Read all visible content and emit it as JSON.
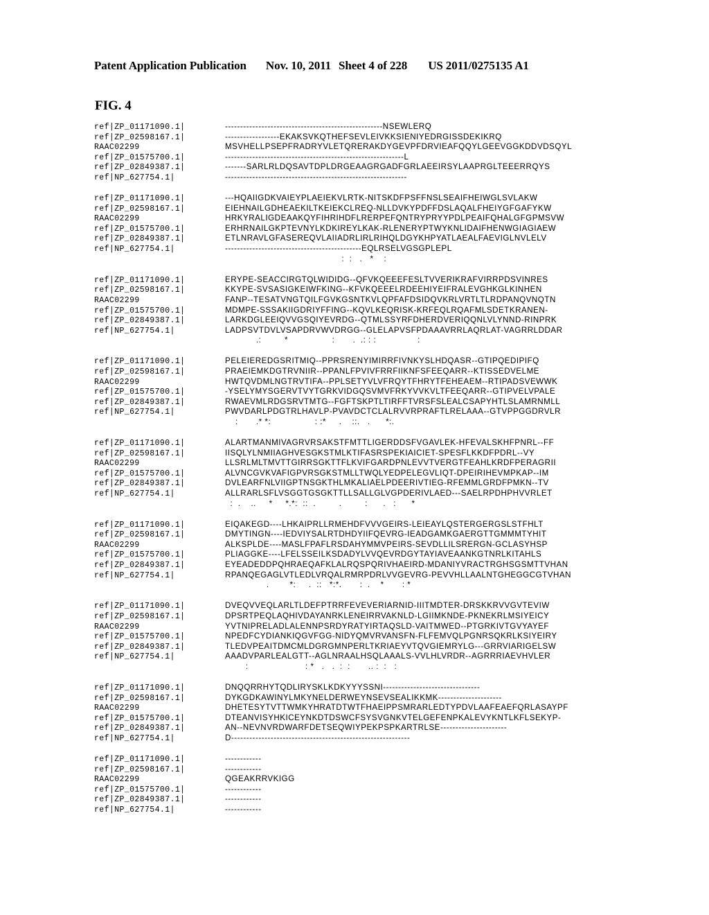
{
  "header": {
    "publication": "Patent Application Publication",
    "date": "Nov. 10, 2011",
    "sheet": "Sheet 4 of 228",
    "patent_number": "US 2011/0275135 A1"
  },
  "figure": {
    "label": "FIG. 4"
  },
  "sequence_labels": [
    "ref|ZP_01171090.1|",
    "ref|ZP_02598167.1|",
    "RAAC02299",
    "ref|ZP_01575700.1|",
    "ref|ZP_02849387.1|",
    "ref|NP_627754.1|"
  ],
  "blocks": [
    {
      "sequences": [
        "----------------------------------------------------NSEWLERQ",
        "------------------EKAKSVKQTHEFSEVLEIVKKSIENIYEDRGISSDEKIKRQ",
        "MSVHELLPSEPFRADRYVLETQRERAKDYGEVPFDRVIEAFQQYLGEEVGGKDDVDSQYL",
        "-----------------------------------------------------------L",
        "-------SARLRLDQSAVTDPLDRGEAAGRGADFGRLAEEIRSYLAAPRGLTEEERRQYS",
        "------------------------------------------------------------"
      ],
      "conservation": ""
    },
    {
      "sequences": [
        "---HQAIIGDKVAIEYPLAEIEKVLRTK-NITSKDFPSFFNSLSEAIFHEIWGLSVLAKW",
        "EIEHNAILGDHEAEKILTKEIEKCLREQ-NLLDVKYPDFFDSLAQALFHEIYGFGAFYKW",
        "HRKYRALIGDEAAKQYFIHRIHDFLRERPEFQNTRYPRYYPDLPEAIFQHALGFGPMSVW",
        "ERHRNAILGKPTEVNYLKDKIREYLKAK-RLENERYPTWYKNLIDAIFHENWGIAGIAEW",
        "ETLNRAVLGFASEREQVLAIIADRLIRLRIHQLDGYKHPYATLAEALFAEVIGLNVLELV",
        "---------------------------------------------EQLRSELVGSGPLEPL"
      ],
      "conservation": "                                             :  :   .   *    :"
    },
    {
      "sequences": [
        "ERYPE-SEACCIRGTQLWIDIDG--QFVKQEEEFESLTVVERIKRAFVIRRPDSVINRES",
        "KKYPE-SVSASIGKEIWFKING--KFVKQEEELRDEEHIYEIFRALEVGHKGLKINHEN",
        "FANP--TESATVNGTQILFGVKGSNTKVLQPFAFDSIDQVKRLVRTLTLRDPANQVNQTN",
        "MDMPE-SSSAKIIGDRIYFFING--KQVLKEQRISK-KRFEQLRQAFMLSDETKRANEN-",
        "LARKDGLEEIQVVGSQIYEVRDG--QTMLSSYRFDHERDVERIQQNLVLYNND-RINPRK",
        "LADPSVTDVLVSAPDRVWVDRGG--GLELAPVSFPDAAAVRRLAQRLAT-VAGRRLDDAR"
      ],
      "conservation": "            .:         *                 :       .  .: : :                :"
    },
    {
      "sequences": [
        "PELEIEREDGSRITMIQ--PPRSRENYIMIRRFIVNKYSLHDQASR--GTIPQEDIPIFQ",
        "PRAEIEMKDGTRVNIIR--PPANLFPVIVFRRFIIKNFSFEEQARR--KTISSEDVELME",
        "HWTQVDMLNGTRVTIFA--PPLSETYVLVFRQYTFHRYTFEHEAEM--RTIPADSVEWWK",
        "-YSELYMYSGERVTVYTGRKVIDGQSVMVFRKYVVKVLTFEEQARR--GTIPVELVPALE",
        "RWAEVMLRDGSRVTMTG--FGFTSKPTLTIRFFTVRSFSLEALCSAPYHTLSLAMRNMLL",
        "PWVDARLPDGTRLHAVLP-PVAVDCTCLALRVVRPRAFTLRELAAA--GTVPPGGDRVLR"
      ],
      "conservation": "    :       .* *:                 : :*     .    ::.   .      *:."
    },
    {
      "sequences": [
        "ALARTMANMIVAGRVRSAKSTFMTTLIGERDDSFVGAVLEK-HFEVALSKHFPNRL--FF",
        "IISQLYLNMIIAGHVESGKSTMLKTIFASRSPEKIAICIET-SPESFLKKDFPDRL--VY",
        "LLSRLMLTMVTTGIRRSGKTTFLKVIFGARDPNLEVVTVERGTFEAHLKRDFPERAGRII",
        "ALVNCGVKVAFIGPVRSGKSTMLLTWQLYEDPELEGVLIQT-DPEIRIHEVMPKAP--IM",
        "DVLEARFNLVIIGPTNSGKTHLMKALIAELPDEERIVTIEG-RFEMMLGRDFPMKN--TV",
        "ALLRARLSFLVSGGTGSGKTTLLSALLGLVGPDERIVLAED---SAELRPDHPHVVRLET"
      ],
      "conservation": "  :  .    ..     *     *.*:  ::  .         .         :      .   :      *"
    },
    {
      "sequences": [
        "EIQAKEGD----LHKAIPRLLRMEHDFVVVGEIRS-LEIEAYLQSTERGERGSLSTFHLT",
        "DMYTINGN----IEDVIYSALRTDHDYIIFQEVRG-IEADGAMKGAERGTTGMMMTYHIT",
        "ALKSPLDE----MASLFPAFLRSDAHYMMVPEIRS-SEVDLLILSRERGN-GCLASYHSP",
        "PLIAGGKE----LFELSSEILKSDADYLVVQEVRDGYTAYIAVEAANKGTNRLKITAHLS",
        "EYEADEDDPQHRAEQAFKLALRQSPQRIVHAEIRD-MDANIYVRACTRGHSGSMTTVHAN",
        "RPANQEGAGLVTLEDLVRQALRMRPDRLVVGEVRG-PEVVHLLAALNTGHEGGCGTVHAN"
      ],
      "conservation": "                .        *:     .  ::   *:*.       :  .    *       : *"
    },
    {
      "sequences": [
        "DVEQVVEQLARLTLDEFPTRRFEVEVERIARNID-IIITMDTER-DRSKKRVVGVTEVIW",
        "DPSRTPEQLAQHIVDAYANRKLENEIRRVAKNLD-LGIIMKNDE-PKNEKRLMSIYEICY",
        "YVTNIPRELADLALENNPSRDYRATYIRTAQSLD-VAITMWED--PTGRKIVTGVYAYEF",
        "NPEDFCYDIANKIQGVFGG-NIDYQMVRVANSFN-FLFEMVQLPGNRSQKRLKSIYEIRY",
        "TLEDVPEAITDMCMLDGRGMNPERLTKRIAEYVTQVGIEMRYLG---GRRVIARIGELSW",
        "AAADVPARLEALGTT--AGLNRAALHSQLAAALS-VVLHLVRDR--AGRRRIAEVHVLER"
      ],
      "conservation": "        :                      : *   .   .  :  :       .. :  :   :"
    },
    {
      "sequences": [
        "DNQQRRHYTQDLIRYSKLKDKYYYSSNI--------------------------------",
        "DYKGDKAWINYLMKYNELDERWEYNSEVSEALIKKMK---------------------",
        "DHETESYTVTTWMKYHRATDTWTFHAEIPPSMRARLEDTYPDVLAAFEAEFQRLASAYPF",
        "DTEANVISYHKICEYNKDTDSWCFSYSVGNKVTELGEFENPKALEVYKNTLKFLSEKYP-",
        "AN--NEVNVRDWARFDETSEQWIYPEKPSPKARTRLSE----------------------",
        "D-----------------------------------------------------------"
      ],
      "conservation": ""
    },
    {
      "sequences": [
        "------------",
        "------------",
        "QGEAKRRVKIGG",
        "------------",
        "------------",
        "------------"
      ],
      "conservation": ""
    }
  ]
}
